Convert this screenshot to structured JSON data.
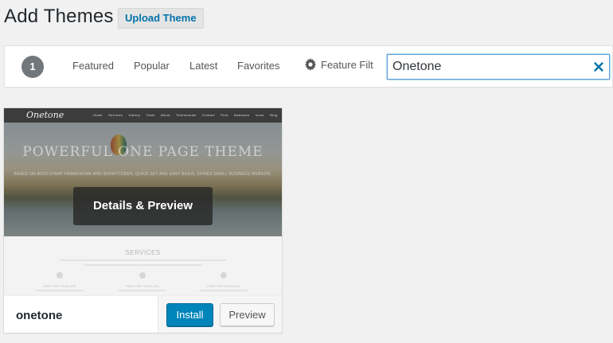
{
  "header": {
    "title": "Add Themes",
    "upload_label": "Upload Theme"
  },
  "filter_bar": {
    "count": "1",
    "links": [
      "Featured",
      "Popular",
      "Latest",
      "Favorites"
    ],
    "feature_filter_label": "Feature Filt",
    "search_value": "Onetone"
  },
  "theme": {
    "name": "onetone",
    "overlay_label": "Details & Preview",
    "install_label": "Install",
    "preview_label": "Preview",
    "screenshot": {
      "logo": "Onetone",
      "menu": "Home Services Gallery Team About Testimonials Contact Font Awesome Icons Blog",
      "headline": "POWERFUL ONE PAGE THEME",
      "subheadline": "BASED ON BOOTSTRAP FRAMEWORK AND SHORTCODES, QUICK SET AND EASY BUILD, SHINES SMALL BUSINESS WEBSITE.",
      "section_title": "SERVICES",
      "columns": [
        "FREE PSD TEMPLATE",
        "FREE PSD TEMPLATE",
        "FREE PSD TEMPLATE"
      ]
    }
  },
  "colors": {
    "primary": "#0085ba",
    "link": "#0073aa",
    "badge": "#72777c",
    "background": "#f1f1f1"
  }
}
